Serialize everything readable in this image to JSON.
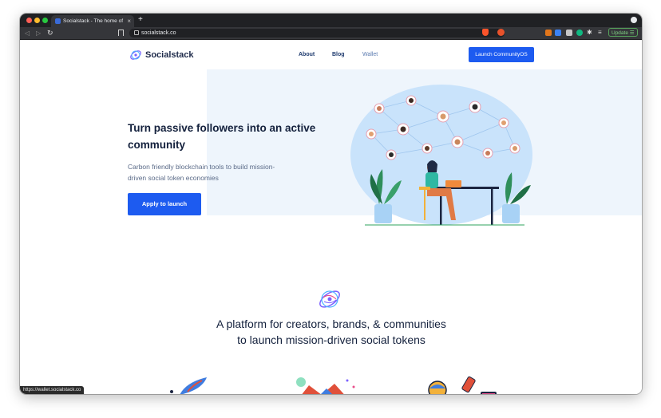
{
  "browser": {
    "tab_title": "Socialstack - The home of mis",
    "url": "socialstack.co",
    "update_label": "Update",
    "status_url": "https://wallet.socialstack.co"
  },
  "nav": {
    "logo_text": "Socialstack",
    "links": [
      "About",
      "Blog",
      "Wallet"
    ],
    "cta": "Launch CommunityOS"
  },
  "hero": {
    "headline": "Turn passive followers into an active community",
    "subhead": "Carbon friendly blockchain tools to build mission-driven social token economies",
    "cta": "Apply to launch"
  },
  "platform": {
    "title_line1": "A platform for creators, brands, & communities",
    "title_line2": "to launch mission-driven social tokens"
  },
  "colors": {
    "accent": "#1d5bf0",
    "heading": "#14213d",
    "hero_bg": "#eef5fc"
  },
  "icons": [
    "lock-icon",
    "bookmark-icon",
    "brave-shield-icon",
    "logo-icon",
    "platform-icon"
  ]
}
